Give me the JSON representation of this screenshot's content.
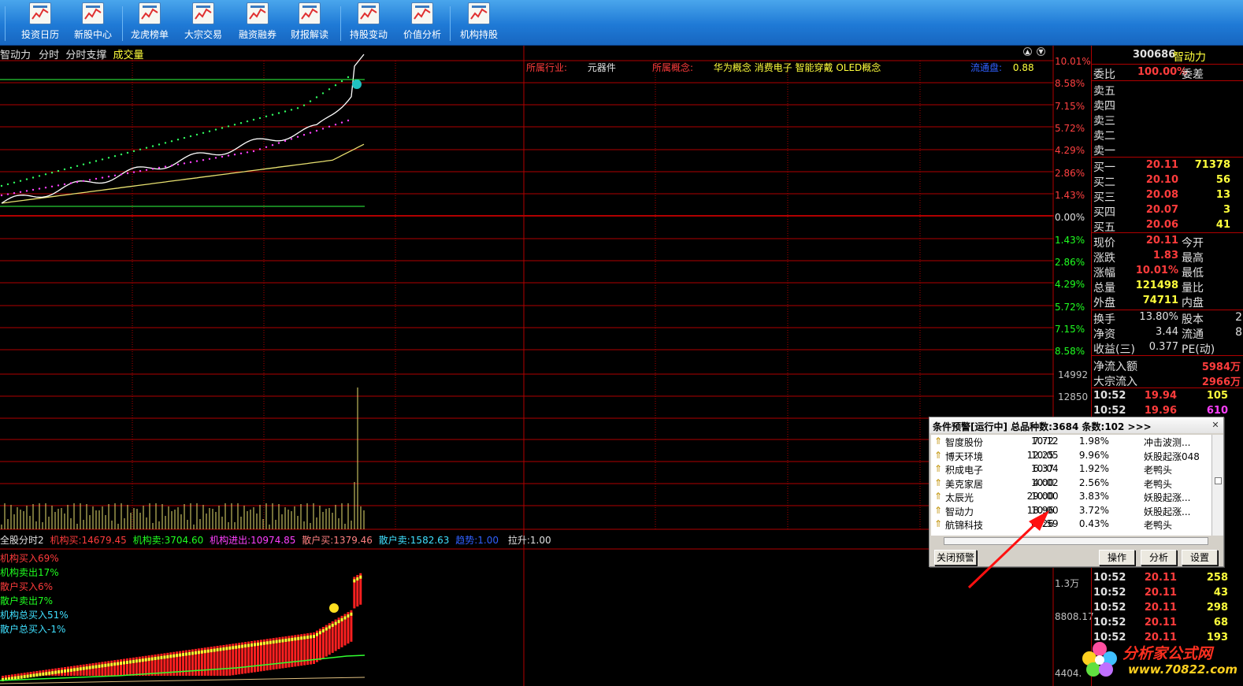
{
  "toolbar": {
    "items": [
      {
        "label": "投资日历",
        "icon": "calendar-icon"
      },
      {
        "label": "新股中心",
        "icon": "new-stock-icon"
      },
      {
        "label": "龙虎榜单",
        "icon": "dragon-tiger-chart-icon"
      },
      {
        "label": "大宗交易",
        "icon": "block-trade-chart-icon"
      },
      {
        "label": "融资融券",
        "icon": "margin-chart-icon"
      },
      {
        "label": "财报解读",
        "icon": "report-icon"
      },
      {
        "label": "持股变动",
        "icon": "holding-change-icon"
      },
      {
        "label": "价值分析",
        "icon": "value-analysis-icon"
      },
      {
        "label": "机构持股",
        "icon": "institution-icon"
      }
    ]
  },
  "chart_header": {
    "stock_name": "智动力",
    "tab_minute": "分时",
    "tab_support": "分时支撑",
    "tab_volume": "成交量"
  },
  "info_line": {
    "industry_label": "所属行业:",
    "industry_value": "元器件",
    "concept_label": "所属概念:",
    "concept_value": "华为概念 消费电子 智能穿戴 OLED概念",
    "float_label": "流通盘:",
    "float_value": "0.88"
  },
  "price_axis": {
    "right": [
      "10.01%",
      "8.58%",
      "7.15%",
      "5.72%",
      "4.29%",
      "2.86%",
      "1.43%",
      "0.00%",
      "1.43%",
      "2.86%",
      "4.29%",
      "5.72%",
      "7.15%",
      "8.58%"
    ]
  },
  "volume_axis": [
    "14992",
    "12850"
  ],
  "indicator_axis": [
    "1.3万",
    "8808.17",
    "4404."
  ],
  "indicator_header": {
    "name": "全股分时2",
    "inst_buy_label": "机构买:",
    "inst_buy": "14679.45",
    "inst_sell_label": "机构卖:",
    "inst_sell": "3704.60",
    "inst_net_label": "机构进出:",
    "inst_net": "10974.85",
    "retail_buy_label": "散户买:",
    "retail_buy": "1379.46",
    "retail_sell_label": "散户卖:",
    "retail_sell": "1582.63",
    "trend_label": "趋势:",
    "trend": "1.00",
    "pull_label": "拉升:",
    "pull": "1.00"
  },
  "indicator_legend": [
    "机构买入69%",
    "机构卖出17%",
    "散户买入6%",
    "散户卖出7%",
    "机构总买入51%",
    "散户总买入-1%"
  ],
  "right_panel": {
    "code": "300686",
    "name": "智动力",
    "ratio_label": "委比",
    "ratio_value": "100.00%",
    "diff_label": "委差",
    "asks": [
      {
        "label": "卖五"
      },
      {
        "label": "卖四"
      },
      {
        "label": "卖三"
      },
      {
        "label": "卖二"
      },
      {
        "label": "卖一"
      }
    ],
    "bids": [
      {
        "label": "买一",
        "price": "20.11",
        "vol": "71378"
      },
      {
        "label": "买二",
        "price": "20.10",
        "vol": "56"
      },
      {
        "label": "买三",
        "price": "20.08",
        "vol": "13"
      },
      {
        "label": "买四",
        "price": "20.07",
        "vol": "3"
      },
      {
        "label": "买五",
        "price": "20.06",
        "vol": "41"
      }
    ],
    "stats": [
      {
        "l1": "现价",
        "v1": "20.11",
        "l2": "今开"
      },
      {
        "l1": "涨跌",
        "v1": "1.83",
        "l2": "最高"
      },
      {
        "l1": "涨幅",
        "v1": "10.01%",
        "l2": "最低"
      },
      {
        "l1": "总量",
        "v1": "121498",
        "l2": "量比"
      },
      {
        "l1": "外盘",
        "v1": "74711",
        "l2": "内盘"
      }
    ],
    "stats2": [
      {
        "l1": "换手",
        "v1": "13.80%",
        "l2": "股本",
        "v2": "2"
      },
      {
        "l1": "净资",
        "v1": "3.44",
        "l2": "流通",
        "v2": "8"
      },
      {
        "l1": "收益(三)",
        "v1": "0.377",
        "l2": "PE(动)",
        "v2": ""
      }
    ],
    "flow": [
      {
        "label": "净流入额",
        "value": "5984万"
      },
      {
        "label": "大宗流入",
        "value": "2966万"
      }
    ],
    "ticks": [
      {
        "time": "10:52",
        "price": "19.94",
        "vol": "105"
      },
      {
        "time": "10:52",
        "price": "19.96",
        "vol": "610"
      },
      {
        "time": "10:52",
        "price": "20.11",
        "vol": "258"
      },
      {
        "time": "10:52",
        "price": "20.11",
        "vol": "43"
      },
      {
        "time": "10:52",
        "price": "20.11",
        "vol": "298"
      },
      {
        "time": "10:52",
        "price": "20.11",
        "vol": "68"
      },
      {
        "time": "10:52",
        "price": "20.11",
        "vol": "193"
      }
    ]
  },
  "popup": {
    "title": "条件预警[运行中] 总品种数:3684 条数:102  >>>",
    "rows": [
      {
        "name": "智度股份",
        "time": "10:12",
        "price": "7.72",
        "pct": "1.98%",
        "signal": "冲击波测..."
      },
      {
        "name": "博天环境",
        "time": "10:05",
        "price": "12.25",
        "pct": "9.96%",
        "signal": "妖股起涨048"
      },
      {
        "name": "积成电子",
        "time": "10:04",
        "price": "6.37",
        "pct": "1.92%",
        "signal": "老鸭头"
      },
      {
        "name": "美克家居",
        "time": "10:02",
        "price": "4.00",
        "pct": "2.56%",
        "signal": "老鸭头"
      },
      {
        "name": "太辰光",
        "time": "10:00",
        "price": "29.00",
        "pct": "3.83%",
        "signal": "妖股起涨..."
      },
      {
        "name": "智动力",
        "time": "10:00",
        "price": "18.96",
        "pct": "3.72%",
        "signal": "妖股起涨..."
      },
      {
        "name": "航锦科技",
        "time": "09:59",
        "price": "6.26",
        "pct": "0.43%",
        "signal": "老鸭头"
      }
    ],
    "btn_close": "关闭预警",
    "btn_op": "操作",
    "btn_analyze": "分析",
    "btn_settings": "设置"
  },
  "watermark": {
    "text": "分析家公式网",
    "url": "www.70822.com"
  },
  "colors": {
    "grid": "#b00000",
    "up": "#ff3c3c",
    "down": "#20ff20",
    "price_line": "#ffffff",
    "avg_line": "#ffff80",
    "toolbar": "#1f7ad6"
  }
}
